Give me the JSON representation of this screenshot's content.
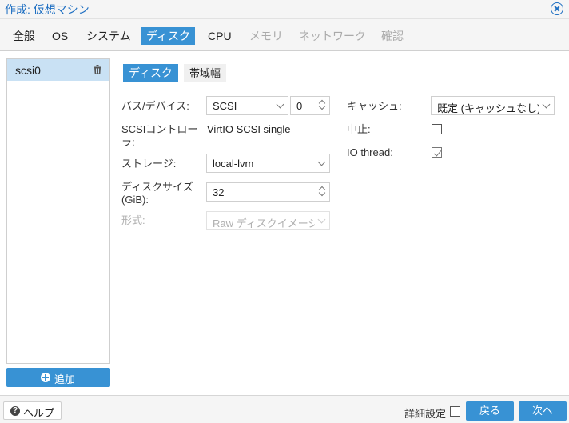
{
  "window": {
    "title": "作成: 仮想マシン"
  },
  "tabs": [
    {
      "label": "全般",
      "state": "normal"
    },
    {
      "label": "OS",
      "state": "normal"
    },
    {
      "label": "システム",
      "state": "normal"
    },
    {
      "label": "ディスク",
      "state": "active"
    },
    {
      "label": "CPU",
      "state": "normal"
    },
    {
      "label": "メモリ",
      "state": "disabled"
    },
    {
      "label": "ネットワーク",
      "state": "disabled"
    },
    {
      "label": "確認",
      "state": "disabled"
    }
  ],
  "disk_list": {
    "items": [
      {
        "label": "scsi0",
        "selected": true
      }
    ],
    "add_label": "追加"
  },
  "subtabs": [
    {
      "label": "ディスク",
      "state": "active"
    },
    {
      "label": "帯域幅",
      "state": "normal"
    }
  ],
  "form": {
    "bus_device": {
      "label": "バス/デバイス:",
      "bus": "SCSI",
      "device": "0"
    },
    "scsi_controller": {
      "label_line1": "SCSIコントロー",
      "label_line2": "ラ:",
      "value": "VirtIO SCSI single"
    },
    "storage": {
      "label": "ストレージ:",
      "value": "local-lvm"
    },
    "disk_size": {
      "label_line1": "ディスクサイズ",
      "label_line2": "(GiB):",
      "value": "32"
    },
    "format": {
      "label": "形式:",
      "value": "Raw ディスクイメージ"
    },
    "cache": {
      "label": "キャッシュ:",
      "value": "既定 (キャッシュなし)"
    },
    "discard": {
      "label": "中止:",
      "checked": false
    },
    "io_thread": {
      "label": "IO thread:",
      "checked": true
    }
  },
  "footer": {
    "help_label": "ヘルプ",
    "advanced_label": "詳細設定",
    "advanced_checked": false,
    "back_label": "戻る",
    "next_label": "次へ"
  },
  "colors": {
    "accent": "#3892d4",
    "selected_row": "#c9e1f4",
    "title": "#1e6fc2"
  }
}
